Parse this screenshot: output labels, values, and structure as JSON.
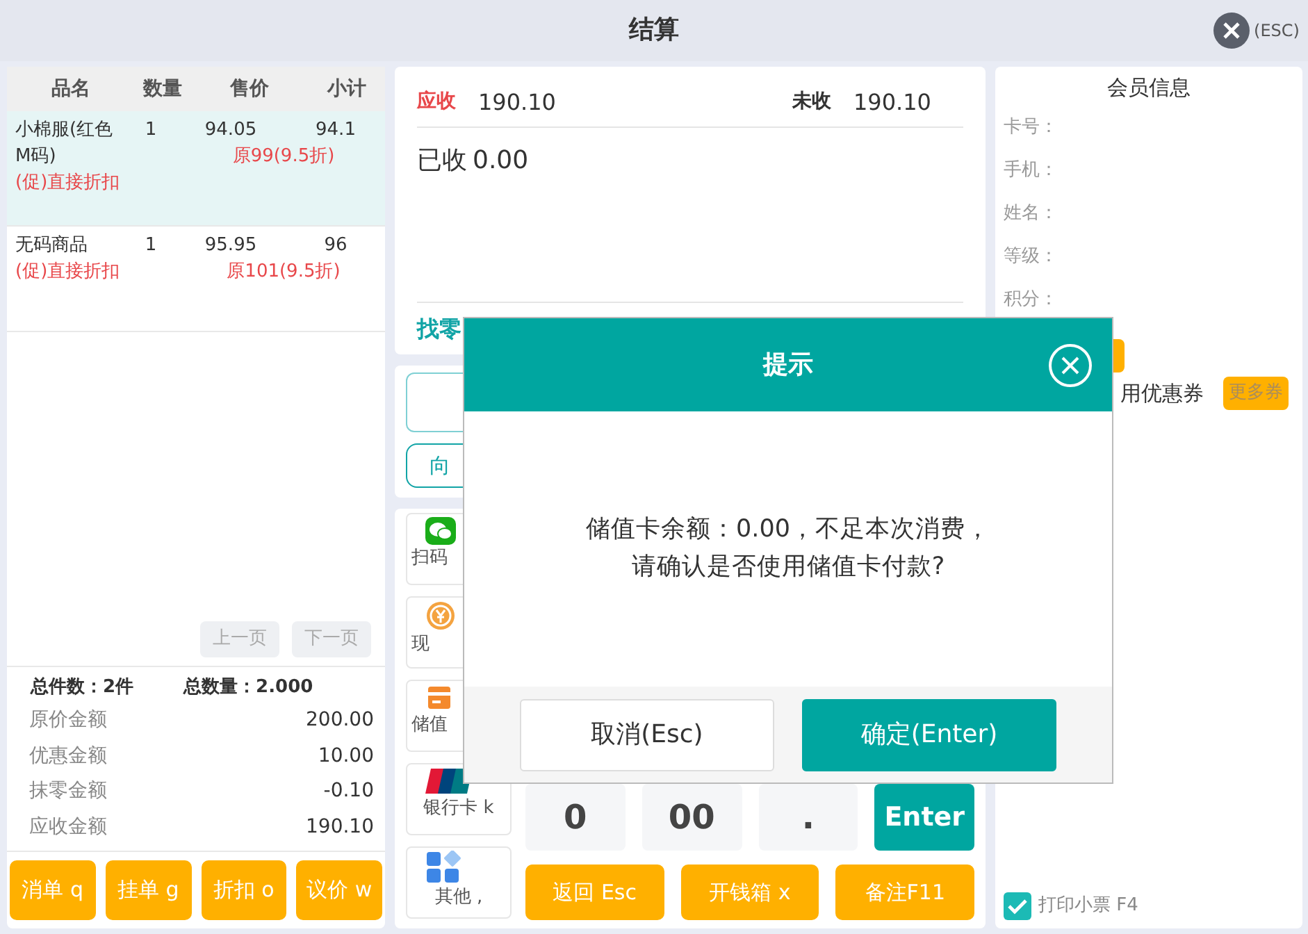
{
  "window": {
    "title": "结算",
    "close_label": "(ESC)"
  },
  "items": {
    "columns": [
      "品名",
      "数量",
      "售价",
      "小计"
    ],
    "rows": [
      {
        "name": "小棉服(红色M码)",
        "qty": "1",
        "price": "94.05",
        "subtotal": "94.1",
        "promo": "(促)直接折扣",
        "original": "原99(9.5折)",
        "selected": true
      },
      {
        "name": "无码商品",
        "qty": "1",
        "price": "95.95",
        "subtotal": "96",
        "promo": "(促)直接折扣",
        "original": "原101(9.5折)",
        "selected": false
      }
    ]
  },
  "pager": [
    {
      "label": "上一页",
      "disabled": true
    },
    {
      "label": "下一页",
      "disabled": true
    }
  ],
  "totals": {
    "count": "总件数：2件",
    "quantity": "总数量：2.000",
    "lines": [
      {
        "label": "原价金额",
        "value": "200.00"
      },
      {
        "label": "优惠金额",
        "value": "10.00"
      },
      {
        "label": "抹零金额",
        "value": "-0.10"
      },
      {
        "label": "应收金额",
        "value": "190.10"
      }
    ]
  },
  "actions": [
    "消单 q",
    "挂单 g",
    "折扣 o",
    "议价 w"
  ],
  "amounts": {
    "due_label": "应收",
    "due": "190.10",
    "unpaid_label": "未收",
    "unpaid": "190.10",
    "paid_label": "已收",
    "paid": "0.00",
    "change_label": "找零"
  },
  "round_button": "向",
  "payments": [
    {
      "kind": "wechat",
      "label": "扫码"
    },
    {
      "kind": "cash",
      "label": "现"
    },
    {
      "kind": "card",
      "label": "储值"
    },
    {
      "kind": "unionpay",
      "label": "银行卡 k"
    },
    {
      "kind": "other",
      "label": "其他 ,"
    }
  ],
  "keypad": [
    {
      "kind": "digit",
      "label": "0"
    },
    {
      "kind": "digit",
      "label": "00"
    },
    {
      "kind": "digit",
      "label": "."
    },
    {
      "kind": "enter",
      "label": "Enter"
    }
  ],
  "bottom_buttons": [
    "返回 Esc",
    "开钱箱 x",
    "备注F11"
  ],
  "member": {
    "title": "会员信息",
    "fields": [
      "卡号：",
      "手机：",
      "姓名：",
      "等级：",
      "积分："
    ],
    "coupon_label": "用优惠券",
    "more_coupons": "更多券"
  },
  "print_receipt": {
    "label": "打印小票 F4",
    "checked": true
  },
  "dialog": {
    "title": "提示",
    "message": [
      "储值卡余额：0.00，不足本次消费，",
      "请确认是否使用储值卡付款?"
    ],
    "buttons": [
      {
        "label": "取消(Esc)",
        "primary": false
      },
      {
        "label": "确定(Enter)",
        "primary": true
      }
    ]
  }
}
